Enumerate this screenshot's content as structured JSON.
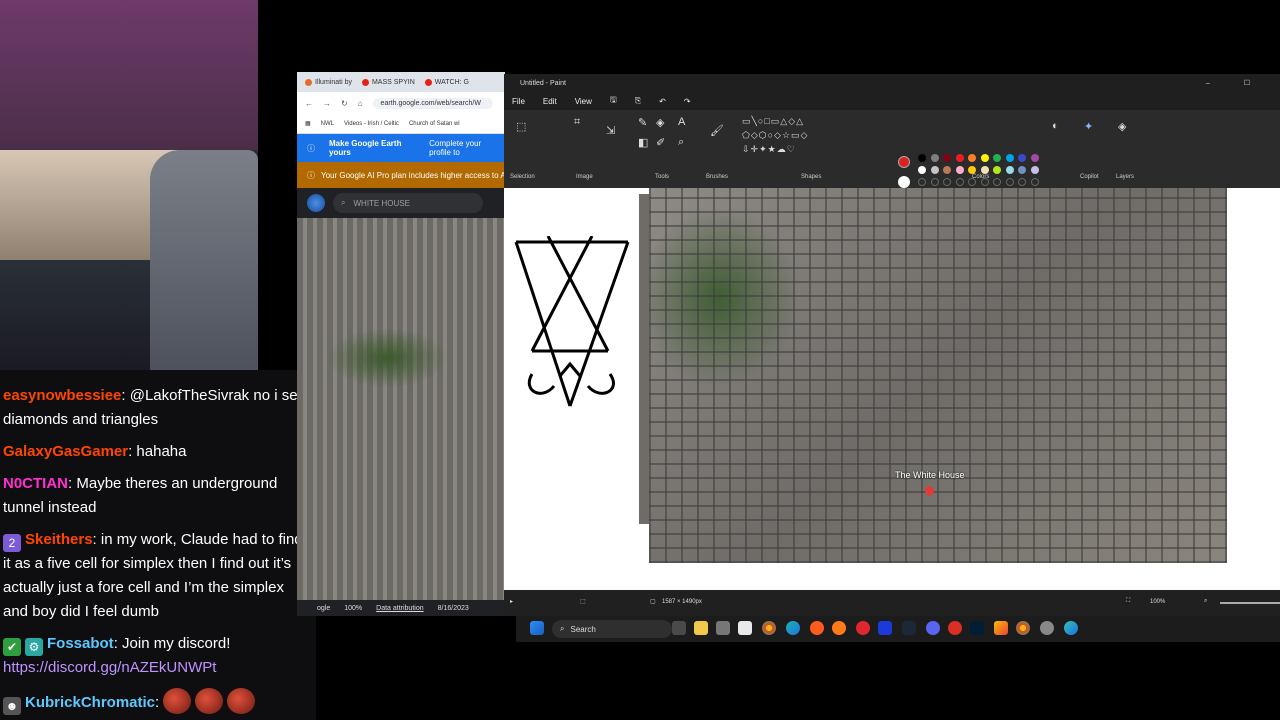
{
  "chat": {
    "messages": [
      {
        "user": "easynowbessiee",
        "color": "#ff4500",
        "text": ": @LakofTheSivrak no i see diamonds and triangles"
      },
      {
        "user": "GalaxyGasGamer",
        "color": "#ff4500",
        "text": ": hahaha"
      },
      {
        "user": "N0CTIAN",
        "color": "#ff2ecf",
        "text": ": Maybe theres an underground tunnel instead"
      },
      {
        "user": "Skeithers",
        "color": "#ff4500",
        "text": ": in my work, Claude had to find it as a five cell for simplex then I find out it’s actually just a fore cell and I’m the simplex and boy did I feel dumb"
      },
      {
        "user": "Fossabot",
        "color": "#5ec8ff",
        "text": ": Join my discord!",
        "link": "https://discord.gg/nAZEkUNWPt"
      },
      {
        "user": "KubrickChromatic",
        "color": "#5ec8ff",
        "text": ":"
      }
    ]
  },
  "browser": {
    "tabs": [
      "Illuminati by",
      "MASS SPYIN",
      "WATCH: G"
    ],
    "url": "earth.google.com/web/search/W",
    "bookmarks": [
      "NWL",
      "Videos - Irish / Celtic",
      "Church of Satan wi"
    ],
    "banner_primary": "Make Google Earth yours",
    "banner_primary_link": "Complete your profile to",
    "banner_secondary": "Your Google AI Pro plan includes higher access to A",
    "search_value": "WHITE HOUSE",
    "footer": {
      "brand": "ogle",
      "scale": "100%",
      "attribution": "Data attribution",
      "date": "8/16/2023"
    }
  },
  "paint": {
    "title": "Untitled - Paint",
    "menu": [
      "File",
      "Edit",
      "View"
    ],
    "groups": [
      "Selection",
      "Image",
      "Tools",
      "Brushes",
      "Shapes",
      "Colors",
      "Copilot",
      "Layers"
    ],
    "canvas_label": "The White House",
    "status": {
      "size": "1587 × 1490px",
      "zoom": "100%"
    },
    "palette": [
      "#000000",
      "#7f7f7f",
      "#880015",
      "#ed1c24",
      "#ff7f27",
      "#fff200",
      "#22b14c",
      "#00a2e8",
      "#3f48cc",
      "#a349a4",
      "#ffffff",
      "#c3c3c3",
      "#b97a57",
      "#ffaec9",
      "#ffc90e",
      "#efe4b0",
      "#b5e61d",
      "#99d9ea",
      "#7092be",
      "#c8bfe7"
    ],
    "active_color": "#e02020"
  },
  "taskbar": {
    "search": "Search"
  }
}
